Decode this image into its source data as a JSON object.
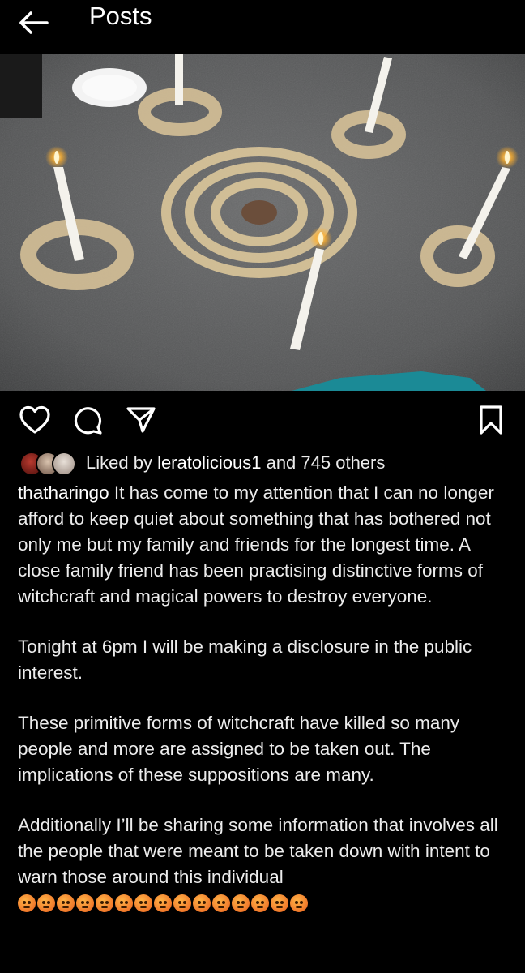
{
  "header": {
    "title": "Posts",
    "back_icon": "arrow-left-icon"
  },
  "post": {
    "photo_alt": "",
    "actions": {
      "like_icon": "heart-icon",
      "comment_icon": "comment-icon",
      "share_icon": "send-icon",
      "save_icon": "bookmark-icon"
    },
    "likes": {
      "prefix": "Liked by ",
      "user": "leratolicious1",
      "suffix": " and 745 others"
    },
    "caption": {
      "username": "thatharingo",
      "paragraph1": " It has come to my attention that I can no longer afford to keep quiet about something that has bothered not only me but my family and friends for the longest time. A close family friend has been practising distinctive forms of witchcraft and magical powers to destroy everyone.",
      "paragraph2": "Tonight at 6pm I will be making a disclosure in the public interest.",
      "paragraph3": "These primitive forms of witchcraft have killed so many people and more are assigned to be taken out. The implications of these suppositions are many.",
      "paragraph4": "Additionally I’ll be sharing some information that involves all the people that were meant to be taken down with intent to warn those around this individual",
      "emoji_icon": "angry-face-icon",
      "emoji_count": 15
    }
  },
  "colors": {
    "background": "#000000",
    "text": "#ececec",
    "floor": "#5a5b5c",
    "sand": "#dcc69a",
    "candle": "#f4f2ec",
    "flame": "#ffb02e"
  }
}
